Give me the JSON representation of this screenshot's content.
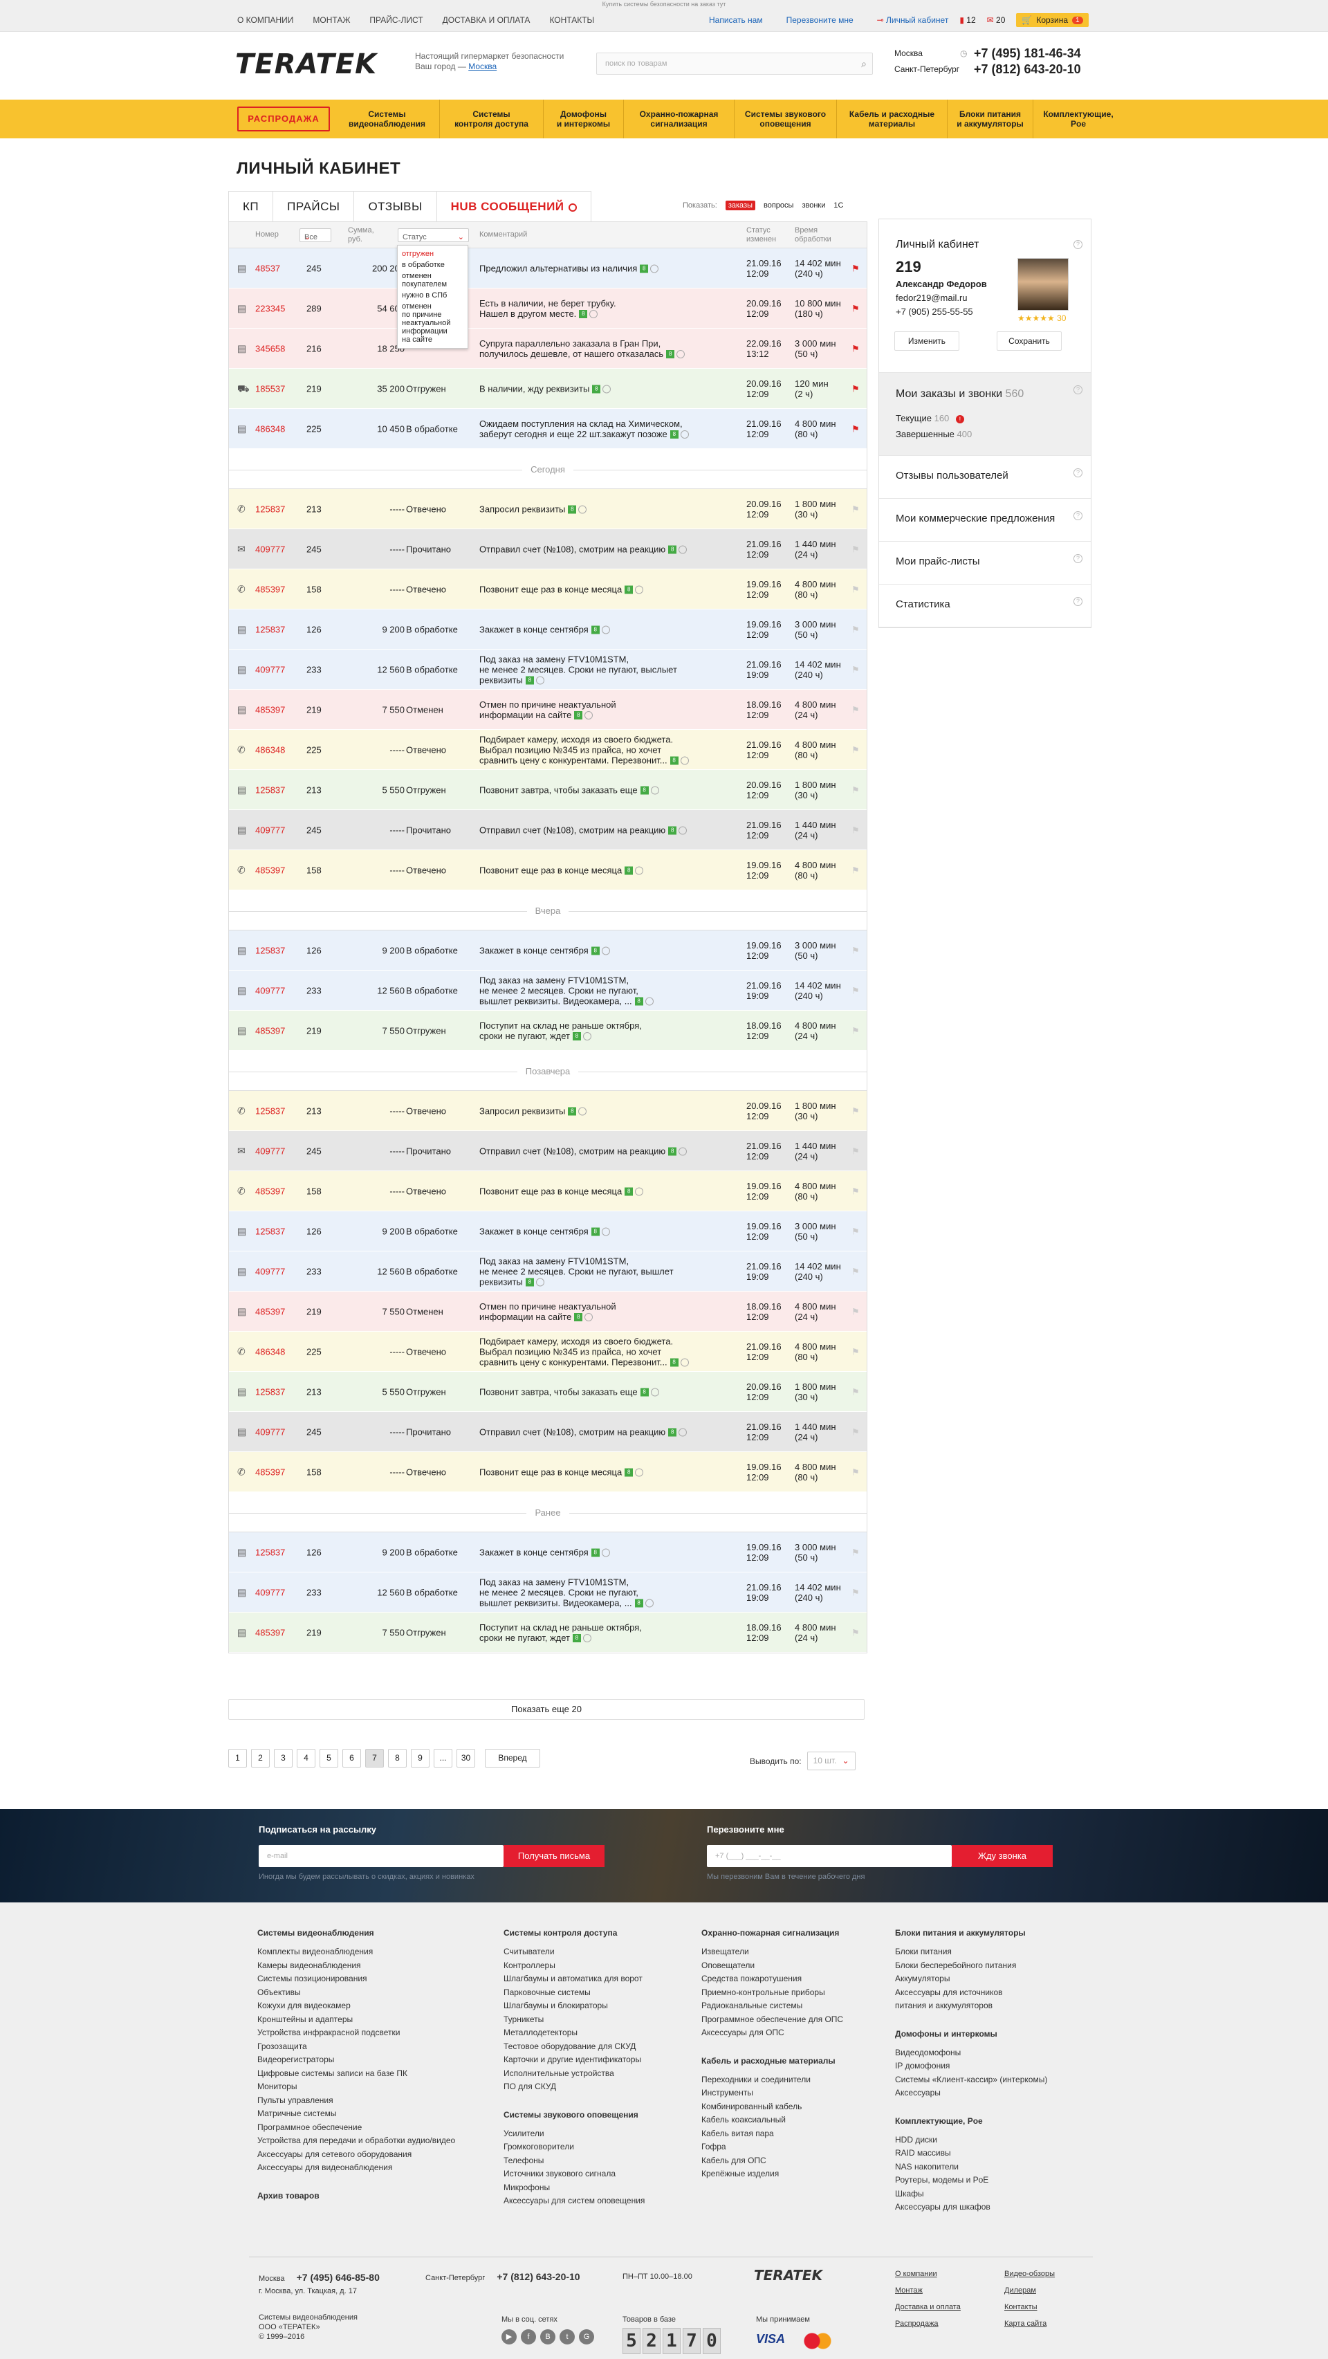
{
  "top_note": "Купить системы безопасности на заказ тут",
  "topnav": [
    "О КОМПАНИИ",
    "МОНТАЖ",
    "ПРАЙС-ЛИСТ",
    "ДОСТАВКА И ОПЛАТА",
    "КОНТАКТЫ"
  ],
  "toplinks": {
    "write": "Написать нам",
    "callback": "Перезвоните мне",
    "cabinet": "Личный кабинет",
    "bookmarks": "12",
    "messages": "20",
    "cart": "Корзина",
    "cart_count": "1"
  },
  "header": {
    "logo": "TERATEK",
    "tagline": "Настоящий гипермаркет безопасности",
    "city_label": "Ваш город —",
    "city": "Москва",
    "search_placeholder": "поиск по товарам",
    "phone_city1": "Москва",
    "phone1": "+7 (495) 181-46-34",
    "phone_city2": "Санкт-Петербург",
    "phone2": "+7 (812) 643-20-10"
  },
  "menu": {
    "sale": "РАСПРОДАЖА",
    "items": [
      "Системы\nвидеонаблюдения",
      "Системы\nконтроля доступа",
      "Домофоны\nи интеркомы",
      "Охранно-пожарная\nсигнализация",
      "Системы звукового\nоповещения",
      "Кабель и расходные\nматериалы",
      "Блоки питания\nи аккумуляторы",
      "Комплектующие,\nPoe"
    ]
  },
  "page_title": "ЛИЧНЫЙ КАБИНЕТ",
  "tabs": [
    "КП",
    "ПРАЙСЫ",
    "ОТЗЫВЫ",
    "HUB СООБЩЕНИЙ"
  ],
  "show": {
    "label": "Показать:",
    "opt1": "заказы",
    "opt2": "вопросы",
    "opt3": "звонки",
    "opt4": "1С"
  },
  "table_head": {
    "number": "Номер",
    "all": "Все",
    "sum": "Сумма,\nруб.",
    "status": "Статус",
    "comment": "Комментарий",
    "changed": "Статус\nизменен",
    "time": "Время\nобработки"
  },
  "status_dropdown": [
    "отгружен",
    "в обработке",
    "отменен\nпокупателем",
    "нужно в СПб",
    "отменен\nпо причине\nнеактуальной\nинформации\nна сайте"
  ],
  "groups": [
    {
      "label": "",
      "rows": [
        {
          "icon": "▤",
          "num": "48537",
          "qty": "245",
          "sum": "200 200",
          "status": "",
          "comment": "Предложил альтернативы из наличия",
          "date": "21.09.16\n12:09",
          "time": "14 402 мин\n(240 ч)",
          "color": "#eaf1fa",
          "flag": true,
          "h": 58
        },
        {
          "icon": "▤",
          "num": "223345",
          "qty": "289",
          "sum": "54 600",
          "status": "",
          "comment": "Есть в наличии, не берет трубку.\nНашел в другом месте.",
          "date": "20.09.16\n12:09",
          "time": "10 800 мин\n(180 ч)",
          "color": "#fbeaea",
          "flag": true,
          "h": 58
        },
        {
          "icon": "▤",
          "num": "345658",
          "qty": "216",
          "sum": "18 250",
          "status": "",
          "comment": "Супруга параллельно заказала в Гран При,\nполучилось дешевле, от нашего отказалась",
          "date": "22.09.16\n13:12",
          "time": "3 000 мин\n(50 ч)",
          "color": "#fbeaea",
          "flag": true,
          "h": 58
        },
        {
          "icon": "⛟",
          "num": "185537",
          "qty": "219",
          "sum": "35 200",
          "status": "Отгружен",
          "comment": "В наличии, жду реквизиты",
          "date": "20.09.16\n12:09",
          "time": "120 мин\n(2 ч)",
          "color": "#edf6e8",
          "flag": true,
          "h": 58
        },
        {
          "icon": "▤",
          "num": "486348",
          "qty": "225",
          "sum": "10 450",
          "status": "В обработке",
          "comment": "Ожидаем поступления на склад на Химическом,\nзаберут сегодня и еще 22 шт.закажут позоже",
          "date": "21.09.16\n12:09",
          "time": "4 800 мин\n(80 ч)",
          "color": "#eaf1fa",
          "flag": true,
          "h": 58
        }
      ]
    },
    {
      "label": "Сегодня",
      "rows": [
        {
          "icon": "✆",
          "num": "125837",
          "qty": "213",
          "sum": "-----",
          "status": "Отвечено",
          "comment": "Запросил реквизиты",
          "date": "20.09.16\n12:09",
          "time": "1 800 мин\n(30 ч)",
          "color": "#fbf8e1",
          "flag": false,
          "h": 58
        },
        {
          "icon": "✉",
          "num": "409777",
          "qty": "245",
          "sum": "-----",
          "status": "Прочитано",
          "comment": "Отправил счет (№108), смотрим на реакцию",
          "date": "21.09.16\n12:09",
          "time": "1 440 мин\n(24 ч)",
          "color": "#e6e6e6",
          "flag": false,
          "h": 58
        },
        {
          "icon": "✆",
          "num": "485397",
          "qty": "158",
          "sum": "-----",
          "status": "Отвечено",
          "comment": "Позвонит еще раз в конце месяца",
          "date": "19.09.16\n12:09",
          "time": "4 800 мин\n(80 ч)",
          "color": "#fbf8e1",
          "flag": false,
          "h": 58
        },
        {
          "icon": "▤",
          "num": "125837",
          "qty": "126",
          "sum": "9 200",
          "status": "В обработке",
          "comment": "Закажет в конце сентября",
          "date": "19.09.16\n12:09",
          "time": "3 000 мин\n(50 ч)",
          "color": "#eaf1fa",
          "flag": false,
          "h": 58
        },
        {
          "icon": "▤",
          "num": "409777",
          "qty": "233",
          "sum": "12 560",
          "status": "В обработке",
          "comment": "Под заказ на замену FTV10M1STM,\nне менее 2 месяцев. Сроки не пугают, выслыет\nреквизиты",
          "date": "21.09.16\n19:09",
          "time": "14 402 мин\n(240 ч)",
          "color": "#eaf1fa",
          "flag": false,
          "h": 58
        },
        {
          "icon": "▤",
          "num": "485397",
          "qty": "219",
          "sum": "7 550",
          "status": "Отменен",
          "comment": "Отмен по причине неактуальной\nинформации на сайте",
          "date": "18.09.16\n12:09",
          "time": "4 800 мин\n(24 ч)",
          "color": "#fbeaea",
          "flag": false,
          "h": 58
        },
        {
          "icon": "✆",
          "num": "486348",
          "qty": "225",
          "sum": "-----",
          "status": "Отвечено",
          "comment": "Подбирает камеру, исходя из своего бюджета.\nВыбрал  позицию №345 из прайса, но хочет\nсравнить цену с конкурентами. Перезвонит...",
          "date": "21.09.16\n12:09",
          "time": "4 800 мин\n(80 ч)",
          "color": "#fbf8e1",
          "flag": false,
          "h": 58
        },
        {
          "icon": "▤",
          "num": "125837",
          "qty": "213",
          "sum": "5 550",
          "status": "Отгружен",
          "comment": "Позвонит завтра, чтобы заказать еще",
          "date": "20.09.16\n12:09",
          "time": "1 800 мин\n(30 ч)",
          "color": "#edf6e8",
          "flag": false,
          "h": 58
        },
        {
          "icon": "▤",
          "num": "409777",
          "qty": "245",
          "sum": "-----",
          "status": "Прочитано",
          "comment": "Отправил счет (№108), смотрим на реакцию",
          "date": "21.09.16\n12:09",
          "time": "1 440 мин\n(24 ч)",
          "color": "#e6e6e6",
          "flag": false,
          "h": 58
        },
        {
          "icon": "✆",
          "num": "485397",
          "qty": "158",
          "sum": "-----",
          "status": "Отвечено",
          "comment": "Позвонит еще раз в конце месяца",
          "date": "19.09.16\n12:09",
          "time": "4 800 мин\n(80 ч)",
          "color": "#fbf8e1",
          "flag": false,
          "h": 58
        }
      ]
    },
    {
      "label": "Вчера",
      "rows": [
        {
          "icon": "▤",
          "num": "125837",
          "qty": "126",
          "sum": "9 200",
          "status": "В обработке",
          "comment": "Закажет в конце сентября",
          "date": "19.09.16\n12:09",
          "time": "3 000 мин\n(50 ч)",
          "color": "#eaf1fa",
          "flag": false,
          "h": 58
        },
        {
          "icon": "▤",
          "num": "409777",
          "qty": "233",
          "sum": "12 560",
          "status": "В обработке",
          "comment": "Под заказ на замену FTV10M1STM,\nне менее 2 месяцев. Сроки не пугают,\nвышлет реквизиты. Видеокамера, ...",
          "date": "21.09.16\n19:09",
          "time": "14 402 мин\n(240 ч)",
          "color": "#eaf1fa",
          "flag": false,
          "h": 58
        },
        {
          "icon": "▤",
          "num": "485397",
          "qty": "219",
          "sum": "7 550",
          "status": "Отгружен",
          "comment": "Поступит на склад не раньше октября,\nсроки не пугают, ждет",
          "date": "18.09.16\n12:09",
          "time": "4 800 мин\n(24 ч)",
          "color": "#edf6e8",
          "flag": false,
          "h": 58
        }
      ]
    },
    {
      "label": "Позавчера",
      "rows": [
        {
          "icon": "✆",
          "num": "125837",
          "qty": "213",
          "sum": "-----",
          "status": "Отвечено",
          "comment": "Запросил реквизиты",
          "date": "20.09.16\n12:09",
          "time": "1 800 мин\n(30 ч)",
          "color": "#fbf8e1",
          "flag": false,
          "h": 58
        },
        {
          "icon": "✉",
          "num": "409777",
          "qty": "245",
          "sum": "-----",
          "status": "Прочитано",
          "comment": "Отправил счет (№108), смотрим на реакцию",
          "date": "21.09.16\n12:09",
          "time": "1 440 мин\n(24 ч)",
          "color": "#e6e6e6",
          "flag": false,
          "h": 58
        },
        {
          "icon": "✆",
          "num": "485397",
          "qty": "158",
          "sum": "-----",
          "status": "Отвечено",
          "comment": "Позвонит еще раз в конце месяца",
          "date": "19.09.16\n12:09",
          "time": "4 800 мин\n(80 ч)",
          "color": "#fbf8e1",
          "flag": false,
          "h": 58
        },
        {
          "icon": "▤",
          "num": "125837",
          "qty": "126",
          "sum": "9 200",
          "status": "В обработке",
          "comment": "Закажет в конце сентября",
          "date": "19.09.16\n12:09",
          "time": "3 000 мин\n(50 ч)",
          "color": "#eaf1fa",
          "flag": false,
          "h": 58
        },
        {
          "icon": "▤",
          "num": "409777",
          "qty": "233",
          "sum": "12 560",
          "status": "В обработке",
          "comment": "Под заказ на замену FTV10M1STM,\nне менее 2 месяцев. Сроки не пугают, вышлет\nреквизиты",
          "date": "21.09.16\n19:09",
          "time": "14 402 мин\n(240 ч)",
          "color": "#eaf1fa",
          "flag": false,
          "h": 58
        },
        {
          "icon": "▤",
          "num": "485397",
          "qty": "219",
          "sum": "7 550",
          "status": "Отменен",
          "comment": "Отмен по причине неактуальной\nинформации на сайте",
          "date": "18.09.16\n12:09",
          "time": "4 800 мин\n(24 ч)",
          "color": "#fbeaea",
          "flag": false,
          "h": 58
        },
        {
          "icon": "✆",
          "num": "486348",
          "qty": "225",
          "sum": "-----",
          "status": "Отвечено",
          "comment": "Подбирает камеру, исходя из своего бюджета.\nВыбрал  позицию №345 из прайса, но хочет\nсравнить цену с конкурентами. Перезвонит...",
          "date": "21.09.16\n12:09",
          "time": "4 800 мин\n(80 ч)",
          "color": "#fbf8e1",
          "flag": false,
          "h": 58
        },
        {
          "icon": "▤",
          "num": "125837",
          "qty": "213",
          "sum": "5 550",
          "status": "Отгружен",
          "comment": "Позвонит завтра, чтобы заказать еще",
          "date": "20.09.16\n12:09",
          "time": "1 800 мин\n(30 ч)",
          "color": "#edf6e8",
          "flag": false,
          "h": 58
        },
        {
          "icon": "▤",
          "num": "409777",
          "qty": "245",
          "sum": "-----",
          "status": "Прочитано",
          "comment": "Отправил счет (№108), смотрим на реакцию",
          "date": "21.09.16\n12:09",
          "time": "1 440 мин\n(24 ч)",
          "color": "#e6e6e6",
          "flag": false,
          "h": 58
        },
        {
          "icon": "✆",
          "num": "485397",
          "qty": "158",
          "sum": "-----",
          "status": "Отвечено",
          "comment": "Позвонит еще раз в конце месяца",
          "date": "19.09.16\n12:09",
          "time": "4 800 мин\n(80 ч)",
          "color": "#fbf8e1",
          "flag": false,
          "h": 58
        }
      ]
    },
    {
      "label": "Ранее",
      "rows": [
        {
          "icon": "▤",
          "num": "125837",
          "qty": "126",
          "sum": "9 200",
          "status": "В обработке",
          "comment": "Закажет в конце сентября",
          "date": "19.09.16\n12:09",
          "time": "3 000 мин\n(50 ч)",
          "color": "#eaf1fa",
          "flag": false,
          "h": 58
        },
        {
          "icon": "▤",
          "num": "409777",
          "qty": "233",
          "sum": "12 560",
          "status": "В обработке",
          "comment": "Под заказ на замену FTV10M1STM,\nне менее 2 месяцев. Сроки не пугают,\nвышлет реквизиты. Видеокамера, ...",
          "date": "21.09.16\n19:09",
          "time": "14 402 мин\n(240 ч)",
          "color": "#eaf1fa",
          "flag": false,
          "h": 58
        },
        {
          "icon": "▤",
          "num": "485397",
          "qty": "219",
          "sum": "7 550",
          "status": "Отгружен",
          "comment": "Поступит на склад не раньше октября,\nсроки не пугают, ждет",
          "date": "18.09.16\n12:09",
          "time": "4 800 мин\n(24 ч)",
          "color": "#edf6e8",
          "flag": false,
          "h": 58
        }
      ]
    }
  ],
  "profile": {
    "title": "Личный кабинет",
    "id": "219",
    "name": "Александр Федоров",
    "email": "fedor219@mail.ru",
    "phone": "+7 (905) 255-55-55",
    "rating": "30",
    "edit": "Изменить",
    "save": "Сохранить",
    "orders_title": "Мои заказы и звонки",
    "orders_count": "560",
    "current_label": "Текущие",
    "current_count": "160",
    "done_label": "Завершенные",
    "done_count": "400",
    "links": [
      "Отзывы пользователей",
      "Мои коммерческие предложения",
      "Мои прайс-листы",
      "Статистика"
    ]
  },
  "more_label": "Показать еще 20",
  "pager": {
    "pages": [
      "1",
      "2",
      "3",
      "4",
      "5",
      "6",
      "7",
      "8",
      "9",
      "...",
      "30"
    ],
    "active": "7",
    "next": "Вперед",
    "perpage_label": "Выводить по:",
    "perpage_value": "10 шт."
  },
  "subscribe": {
    "title": "Подписаться на рассылку",
    "placeholder": "e-mail",
    "button": "Получать письма",
    "note": "Иногда мы будем рассылывать о скидках, акциях и новинках"
  },
  "callback": {
    "title": "Перезвоните мне",
    "placeholder": "+7 (___) ___-__-__",
    "button": "Жду звонка",
    "note": "Мы перезвоним Вам в течение рабочего дня"
  },
  "footer_cols": [
    {
      "blocks": [
        {
          "title": "Системы видеонаблюдения",
          "items": [
            "Комплекты видеонаблюдения",
            "Камеры видеонаблюдения",
            "Системы позиционирования",
            "Объективы",
            "Кожухи для видеокамер",
            "Кронштейны и адаптеры",
            "Устройства инфракрасной подсветки",
            "Грозозащита",
            "Видеорегистраторы",
            "Цифровые системы записи на базе ПК",
            "Мониторы",
            "Пульты управления",
            "Матричные системы",
            "Программное обеспечение",
            "Устройства для передачи и обработки аудио/видео",
            "Аксессуары для сетевого оборудования",
            "Аксессуары для видеонаблюдения"
          ]
        },
        {
          "title": "Архив товаров",
          "items": []
        }
      ]
    },
    {
      "blocks": [
        {
          "title": "Системы контроля доступа",
          "items": [
            "Считыватели",
            "Контроллеры",
            "Шлагбаумы и автоматика для ворот",
            "Парковочные системы",
            "Шлагбаумы и блокираторы",
            "Турникеты",
            "Металлодетекторы",
            "Тестовое оборудование для СКУД",
            "Карточки и другие идентификаторы",
            "Исполнительные устройства",
            "ПО для СКУД"
          ]
        },
        {
          "title": "Системы звукового оповещения",
          "items": [
            "Усилители",
            "Громкоговорители",
            "Телефоны",
            "Источники звукового сигнала",
            "Микрофоны",
            "Аксессуары для систем оповещения"
          ]
        }
      ]
    },
    {
      "blocks": [
        {
          "title": "Охранно-пожарная сигнализация",
          "items": [
            "Извещатели",
            "Оповещатели",
            "Средства пожаротушения",
            "Приемно-контрольные приборы",
            "Радиоканальные системы",
            "Программное обеспечение для ОПС",
            "Аксессуары для ОПС"
          ]
        },
        {
          "title": "Кабель и расходные материалы",
          "items": [
            "Переходники и соединители",
            "Инструменты",
            "Комбинированный кабель",
            "Кабель коаксиальный",
            "Кабель витая пара",
            "Гофра",
            "Кабель для ОПС",
            "Крепёжные изделия"
          ]
        }
      ]
    },
    {
      "blocks": [
        {
          "title": "Блоки питания и аккумуляторы",
          "items": [
            "Блоки питания",
            "Блоки бесперебойного питания",
            "Аккумуляторы",
            "Аксессуары для источников\nпитания и аккумуляторов"
          ]
        },
        {
          "title": "Домофоны и интеркомы",
          "items": [
            "Видеодомофоны",
            "IP домофония",
            "Системы «Клиент-кассир» (интеркомы)",
            "Аксессуары"
          ]
        },
        {
          "title": "Комплектующие, Poe",
          "items": [
            "HDD диски",
            "RAID массивы",
            "NAS накопители",
            "Роутеры, модемы и PoE",
            "Шкафы",
            "Аксессуары для шкафов"
          ]
        }
      ]
    }
  ],
  "footer_bottom": {
    "msk_city": "Москва",
    "msk_phone": "+7 (495) 646-85-80",
    "address": "г. Москва, ул. Ткацкая, д. 17",
    "spb_city": "Санкт-Петербург",
    "spb_phone": "+7 (812) 643-20-10",
    "hours": "ПН–ПТ 10.00–18.00",
    "company": "Системы видеонаблюдения\nООО «ТЕРАТЕК»\n© 1999–2016",
    "social_label": "Мы в соц. сетях",
    "goods_label": "Товаров в базе",
    "goods_digits": [
      "5",
      "2",
      "1",
      "7",
      "0"
    ],
    "accept_label": "Мы принимаем",
    "visa": "VISA",
    "mc": "MasterCard",
    "links1": [
      "О компании",
      "Монтаж",
      "Доставка и оплата",
      "Распродажа"
    ],
    "links2": [
      "Видео-обзоры",
      "Дилерам",
      "Контакты",
      "Карта сайта"
    ]
  }
}
